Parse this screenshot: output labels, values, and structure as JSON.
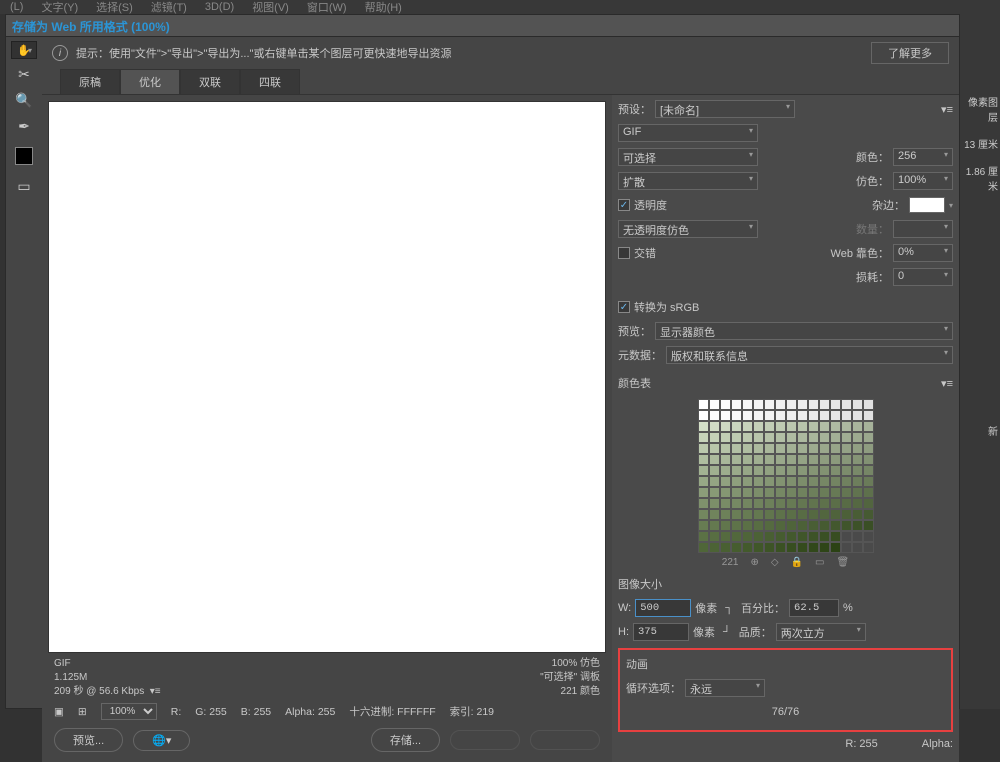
{
  "menu": [
    "(L)",
    "文字(Y)",
    "选择(S)",
    "滤镜(T)",
    "3D(D)",
    "视图(V)",
    "窗口(W)",
    "帮助(H)"
  ],
  "title": "存储为 Web 所用格式 (100%)",
  "hint": "提示：使用\"文件\">\"导出\">\"导出为...\"或右键单击某个图层可更快速地导出资源",
  "learn": "了解更多",
  "tabs": [
    "原稿",
    "优化",
    "双联",
    "四联"
  ],
  "preview": {
    "fmt": "GIF",
    "size": "1.125M",
    "time": "209 秒 @ 56.6 Kbps",
    "zoom": "100% 仿色",
    "palette": "\"可选择\" 调板",
    "colors": "221 颜色"
  },
  "status": {
    "zoom": "100%",
    "r": "R:",
    "g": "G: 255",
    "b": "B: 255",
    "alpha": "Alpha: 255",
    "hex": "十六进制: FFFFFF",
    "index": "索引: 219"
  },
  "opts": {
    "preset_lbl": "预设：",
    "preset": "[未命名]",
    "format": "GIF",
    "reduction": "可选择",
    "colors_lbl": "颜色：",
    "colors": "256",
    "dither_method": "扩散",
    "dither_lbl": "仿色：",
    "dither": "100%",
    "trans": "透明度",
    "matte_lbl": "杂边：",
    "trans_dither": "无透明度仿色",
    "amount_lbl": "数量：",
    "interlace": "交错",
    "websnap_lbl": "Web 靠色：",
    "websnap": "0%",
    "lossy_lbl": "损耗：",
    "lossy": "0",
    "srgb": "转换为 sRGB",
    "preview_lbl": "预览：",
    "preview": "显示器颜色",
    "meta_lbl": "元数据：",
    "meta": "版权和联系信息",
    "coltable": "颜色表",
    "colcount": "221"
  },
  "size": {
    "title": "图像大小",
    "w_lbl": "W:",
    "w": "500",
    "h_lbl": "H:",
    "h": "375",
    "px": "像素",
    "pct_lbl": "百分比：",
    "pct": "62.5",
    "pct_unit": "%",
    "quality_lbl": "品质：",
    "quality": "两次立方"
  },
  "anim": {
    "title": "动画",
    "loop_lbl": "循环选项：",
    "loop": "永远",
    "frame": "76/76",
    "r": "R: 255",
    "alpha": "Alpha:"
  },
  "footer": {
    "preview": "预览...",
    "save": "存储..."
  },
  "bgpanel": {
    "p1": "像素图层",
    "p2": "13 厘米",
    "p3": "1.86 厘米",
    "p4": "新"
  }
}
